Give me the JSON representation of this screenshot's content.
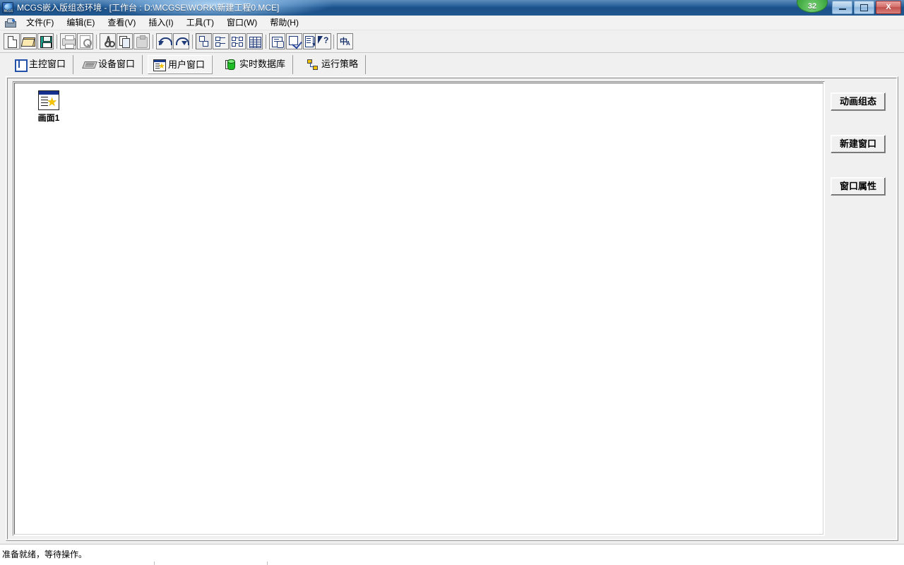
{
  "window": {
    "title": "MCGS嵌入版组态环境 - [工作台 : D:\\MCGSE\\WORK\\新建工程0.MCE]",
    "app_icon": "mcgs-icon",
    "badge": "32",
    "controls": {
      "minimize": "–",
      "maximize": "❐",
      "close": "X"
    },
    "mdi_controls": {
      "minimize": "_",
      "restore": "❐",
      "close": "✕"
    }
  },
  "menubar": {
    "icon": "document-window-icon",
    "items": [
      {
        "label": "文件(F)"
      },
      {
        "label": "编辑(E)"
      },
      {
        "label": "查看(V)"
      },
      {
        "label": "插入(I)"
      },
      {
        "label": "工具(T)"
      },
      {
        "label": "窗口(W)"
      },
      {
        "label": "帮助(H)"
      }
    ]
  },
  "toolbar": {
    "buttons": [
      {
        "name": "new-icon",
        "enabled": true
      },
      {
        "name": "open-icon",
        "enabled": true
      },
      {
        "name": "save-icon",
        "enabled": true
      },
      {
        "name": "print-icon",
        "enabled": false
      },
      {
        "name": "print-preview-icon",
        "enabled": false
      },
      {
        "name": "cut-icon",
        "enabled": true
      },
      {
        "name": "copy-icon",
        "enabled": true
      },
      {
        "name": "paste-icon",
        "enabled": false
      },
      {
        "name": "undo-icon",
        "enabled": true
      },
      {
        "name": "redo-icon",
        "enabled": true
      },
      {
        "name": "large-icons-icon",
        "enabled": true
      },
      {
        "name": "small-icons-icon",
        "enabled": true
      },
      {
        "name": "list-icon",
        "enabled": true
      },
      {
        "name": "details-icon",
        "enabled": true
      },
      {
        "name": "properties-icon",
        "enabled": true
      },
      {
        "name": "check-icon",
        "enabled": true
      },
      {
        "name": "sort-icon",
        "enabled": true
      },
      {
        "name": "help-pointer-icon",
        "enabled": true
      },
      {
        "name": "language-icon",
        "enabled": true
      }
    ],
    "language_combo": {
      "value": "Chinese",
      "name": "language-select"
    }
  },
  "tabs": [
    {
      "id": "main-window",
      "label": "主控窗口",
      "icon": "main-window-icon",
      "active": false
    },
    {
      "id": "device-window",
      "label": "设备窗口",
      "icon": "device-icon",
      "active": false
    },
    {
      "id": "user-window",
      "label": "用户窗口",
      "icon": "user-window-icon",
      "active": true
    },
    {
      "id": "realtime-db",
      "label": "实时数据库",
      "icon": "database-icon",
      "active": false
    },
    {
      "id": "run-strategy",
      "label": "运行策略",
      "icon": "strategy-icon",
      "active": false
    }
  ],
  "workspace": {
    "items": [
      {
        "label": "画面1",
        "icon": "user-window-item-icon"
      }
    ]
  },
  "side_panel": {
    "buttons": [
      {
        "id": "animation-config",
        "label": "动画组态"
      },
      {
        "id": "new-window",
        "label": "新建窗口"
      },
      {
        "id": "window-property",
        "label": "窗口属性"
      }
    ]
  },
  "statusbar": {
    "message": "准备就绪，等待操作。"
  }
}
